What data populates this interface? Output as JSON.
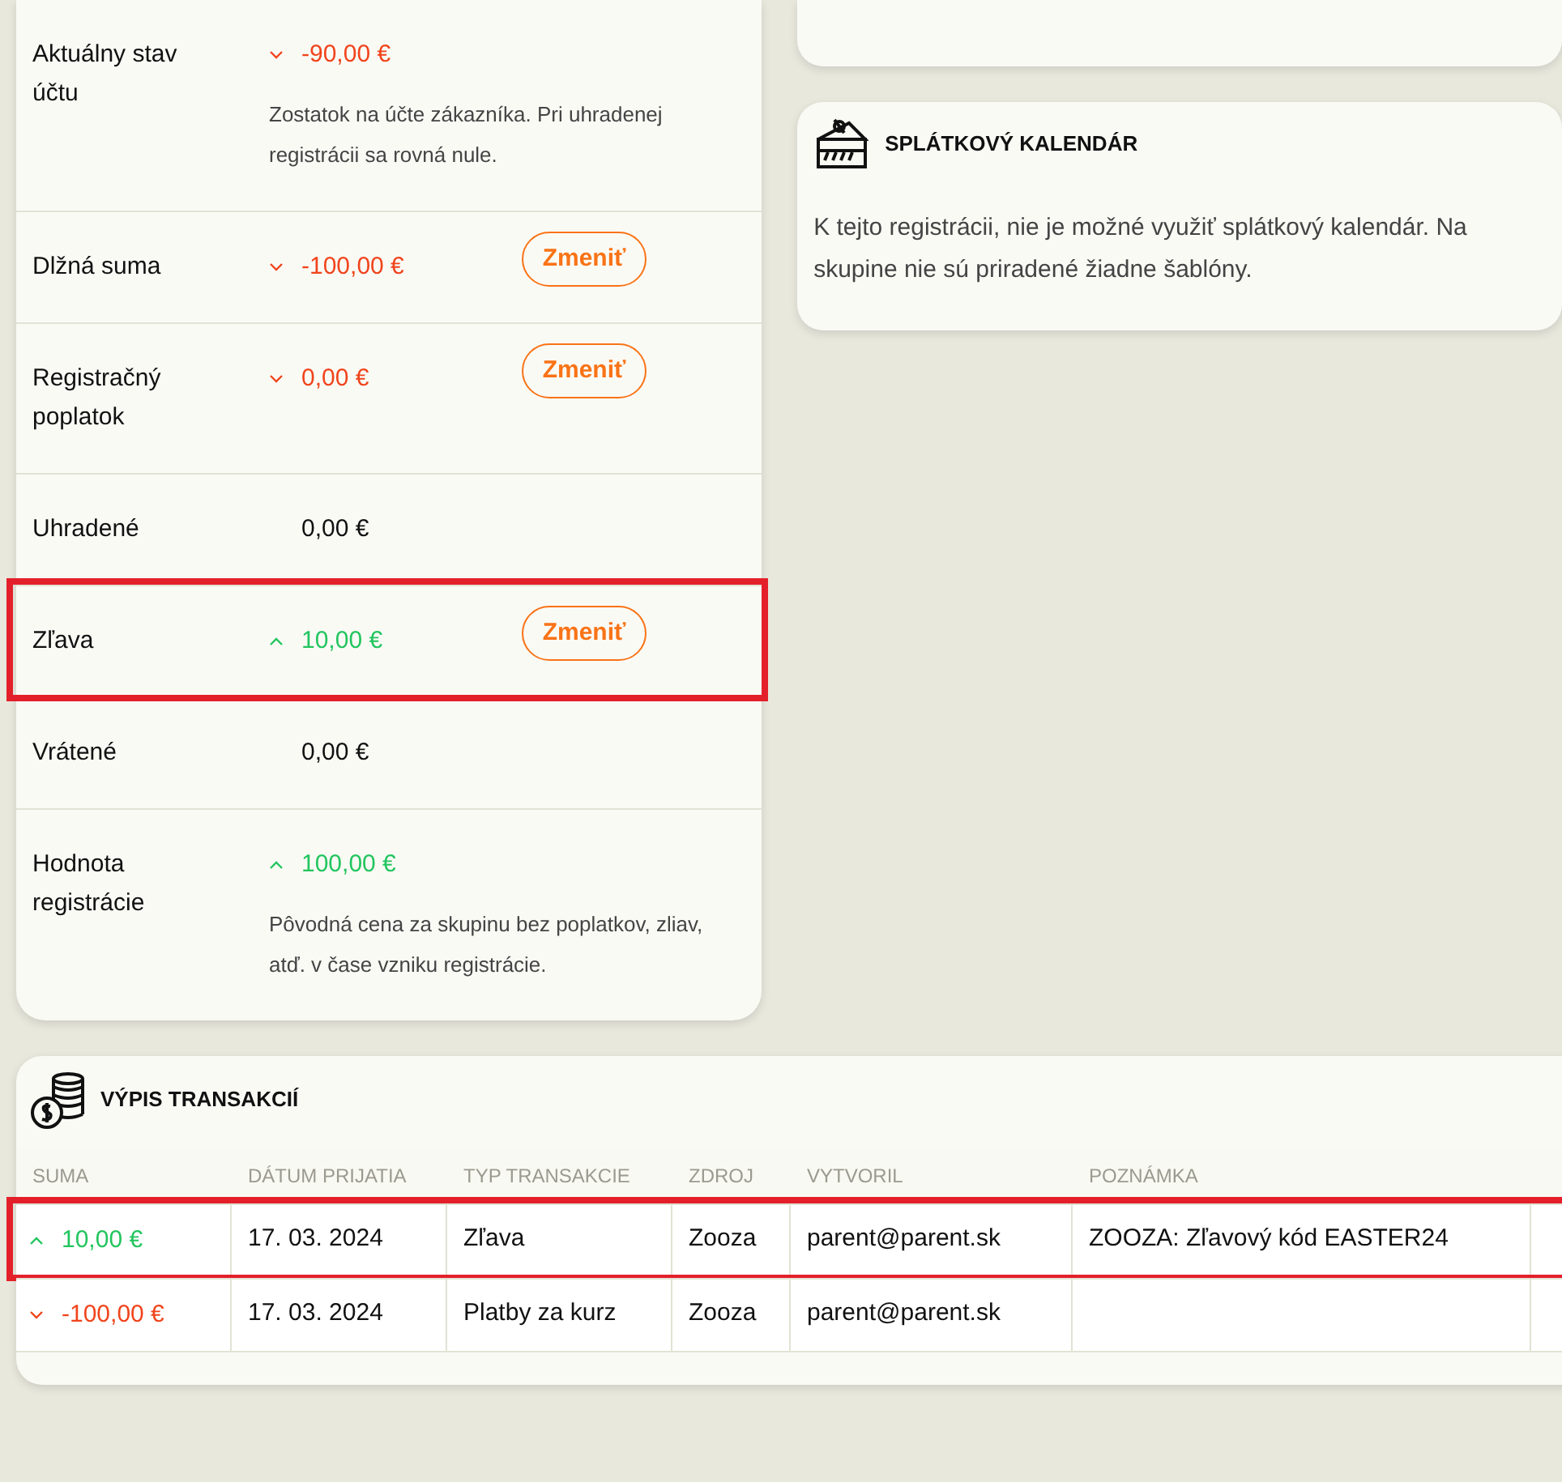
{
  "balance_rows": [
    {
      "label": "Aktuálny stav účtu",
      "kind": "decrease",
      "amount": "-90,00 €",
      "note": "Zostatok na účte zákazníka. Pri uhradenej registrácii sa rovná nule.",
      "highlighted": false
    },
    {
      "label": "Dlžná suma",
      "kind": "decrease",
      "amount": "-100,00 €",
      "button": "Zmeniť",
      "highlighted": false
    },
    {
      "label": "Registračný poplatok",
      "kind": "decrease",
      "amount": "0,00 €",
      "button": "Zmeniť",
      "highlighted": false
    },
    {
      "label": "Uhradené",
      "kind": "neutral",
      "amount": "0,00 €",
      "highlighted": false
    },
    {
      "label": "Zľava",
      "kind": "increase",
      "amount": "10,00 €",
      "button": "Zmeniť",
      "highlighted": true
    },
    {
      "label": "Vrátené",
      "kind": "neutral",
      "amount": "0,00 €",
      "highlighted": false
    },
    {
      "label": "Hodnota registrácie",
      "kind": "increase",
      "amount": "100,00 €",
      "note": "Pôvodná cena za skupinu bez poplatkov, zliav, atď. v čase vzniku registrácie.",
      "highlighted": false
    }
  ],
  "installment_card": {
    "title": "SPLÁTKOVÝ KALENDÁR",
    "text": "K tejto registrácii, nie je možné využiť splátkový kalendár. Na skupine nie sú priradené žiadne šablóny."
  },
  "transactions": {
    "title": "VÝPIS TRANSAKCIÍ",
    "columns": [
      "SUMA",
      "DÁTUM PRIJATIA",
      "TYP TRANSAKCIE",
      "ZDROJ",
      "VYTVORIL",
      "POZNÁMKA"
    ],
    "rows": [
      {
        "kind": "increase",
        "amount": "10,00 €",
        "date": "17. 03. 2024",
        "type": "Zľava",
        "source": "Zooza",
        "created_by": "parent@parent.sk",
        "note": "ZOOZA: Zľavový kód EASTER24",
        "highlighted": true
      },
      {
        "kind": "decrease",
        "amount": "-100,00 €",
        "date": "17. 03. 2024",
        "type": "Platby za kurz",
        "source": "Zooza",
        "created_by": "parent@parent.sk",
        "highlighted": false
      }
    ]
  }
}
